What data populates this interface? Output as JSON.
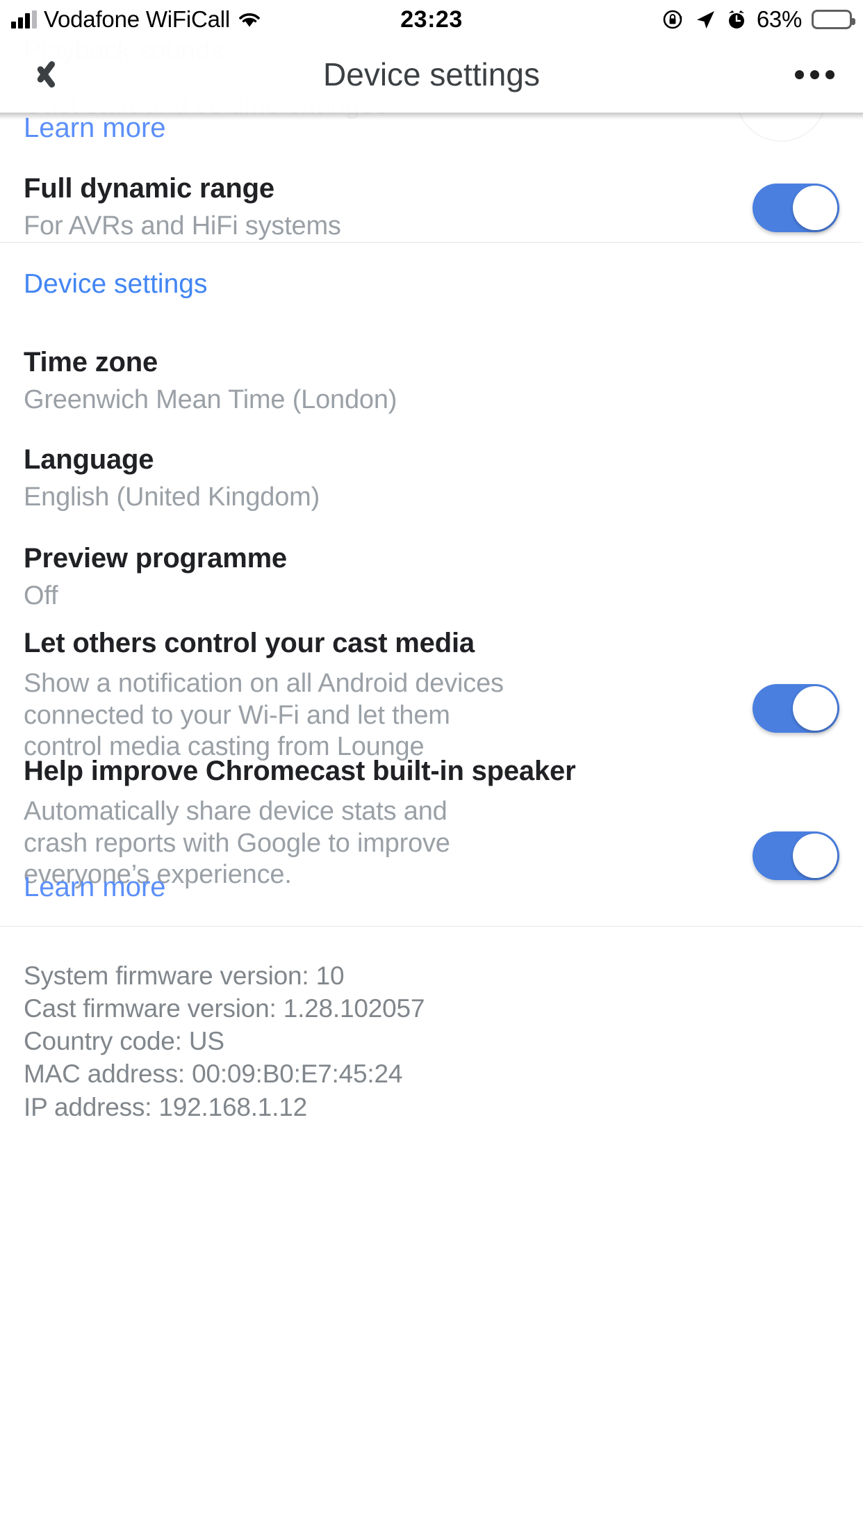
{
  "status_bar": {
    "carrier": "Vodafone WiFiCall",
    "time": "23:23",
    "battery_percent": "63%",
    "icons": [
      "signal-bars-icon",
      "wifi-icon",
      "rotation-lock-icon",
      "location-arrow-icon",
      "alarm-clock-icon",
      "battery-icon"
    ]
  },
  "ghost": {
    "line1": "Playback sounds",
    "line2": "Cast start and volume changes"
  },
  "header": {
    "title": "Device settings",
    "back_icon": "chevron-left-icon",
    "overflow_icon": "more-horizontal-icon"
  },
  "content": {
    "learn_more_top": "Learn more",
    "full_dynamic_range": {
      "title": "Full dynamic range",
      "subtitle": "For AVRs and HiFi systems",
      "toggle_on": true
    },
    "section_device_settings": "Device settings",
    "time_zone": {
      "title": "Time zone",
      "value": "Greenwich Mean Time (London)"
    },
    "language": {
      "title": "Language",
      "value": "English (United Kingdom)"
    },
    "preview_programme": {
      "title": "Preview programme",
      "value": "Off"
    },
    "cast_media": {
      "title": "Let others control your cast media",
      "subtitle": "Show a notification on all Android devices connected to your Wi-Fi and let them control media casting from Lounge",
      "toggle_on": true
    },
    "help_improve": {
      "title": "Help improve Chromecast built-in speaker",
      "subtitle": "Automatically share device stats and crash reports with Google to improve everyone’s experience.",
      "toggle_on": true
    },
    "learn_more_bottom": "Learn more"
  },
  "device_info": {
    "system_firmware": "System firmware version: 10",
    "cast_firmware": "Cast firmware version: 1.28.102057",
    "country_code": "Country code: US",
    "mac_address": "MAC address: 00:09:B0:E7:45:24",
    "ip_address": "IP address: 192.168.1.12"
  },
  "colors": {
    "link_blue": "#5b8ff9",
    "section_blue": "#4285f4",
    "toggle_on": "#4a7fe0",
    "title_text": "#202124",
    "secondary_text": "#9aa0a6",
    "footer_text": "#80868b"
  }
}
